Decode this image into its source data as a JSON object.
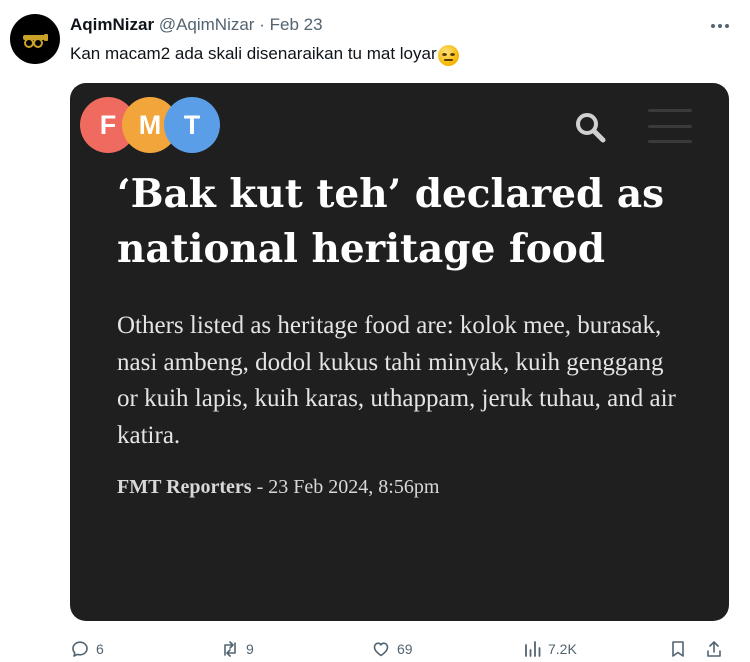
{
  "tweet": {
    "display_name": "AqimNizar",
    "handle": "@AqimNizar",
    "separator": "·",
    "date": "Feb 23",
    "text": "Kan macam2 ada skali disenaraikan tu mat loyar",
    "emoji": "face-with-rolling-eyes"
  },
  "card": {
    "logo": {
      "letters": [
        "F",
        "M",
        "T"
      ],
      "colors": [
        "#ef6b5f",
        "#f2a53b",
        "#5b9ee8"
      ]
    },
    "headline": "‘Bak kut teh’ declared as national heritage food",
    "summary": "Others listed as heritage food are: kolok mee, burasak, nasi ambeng, dodol kukus tahi minyak, kuih genggang or kuih lapis, kuih karas, uthappam, jeruk tuhau, and air katira.",
    "byline": {
      "author": "FMT Reporters",
      "separator": " - ",
      "datetime": "23 Feb 2024, 8:56pm"
    },
    "background": "#1f1f1f"
  },
  "actions": {
    "replies": "6",
    "reposts": "9",
    "likes": "69",
    "views": "7.2K"
  },
  "colors": {
    "text_primary": "#0f1419",
    "text_secondary": "#536471"
  }
}
